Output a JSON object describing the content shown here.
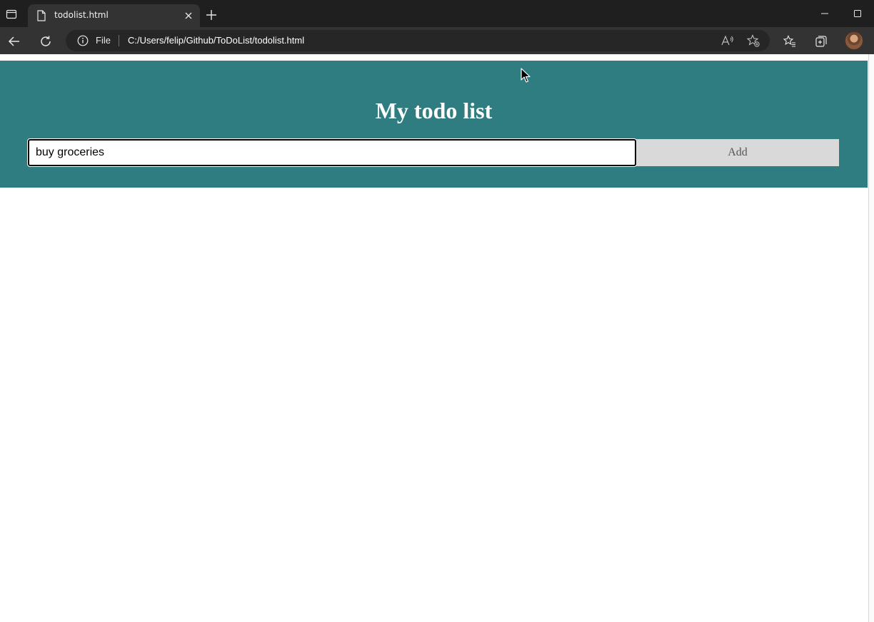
{
  "browser": {
    "tab": {
      "title": "todolist.html"
    },
    "address_bar": {
      "scheme_label": "File",
      "url": "C:/Users/felip/Github/ToDoList/todolist.html"
    }
  },
  "page": {
    "header": {
      "title": "My todo list",
      "background_color": "#2f7d80"
    },
    "todo_input": {
      "value": "buy groceries"
    },
    "add_button": {
      "label": "Add"
    }
  },
  "icons": [
    "tab-actions-icon",
    "document-icon",
    "close-icon",
    "new-tab-icon",
    "minimize-icon",
    "maximize-icon",
    "back-icon",
    "refresh-icon",
    "info-icon",
    "read-aloud-icon",
    "add-favorite-icon",
    "favorites-icon",
    "collections-icon",
    "mouse-pointer-icon"
  ]
}
